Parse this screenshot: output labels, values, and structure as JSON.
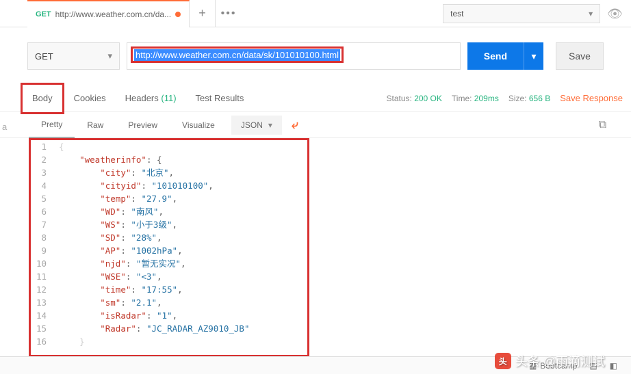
{
  "env": {
    "selected": "test"
  },
  "tab": {
    "method": "GET",
    "title": "http://www.weather.com.cn/da..."
  },
  "request": {
    "method": "GET",
    "url": "http://www.weather.com.cn/data/sk/101010100.html",
    "send": "Send",
    "save": "Save"
  },
  "respTabs": {
    "body": "Body",
    "cookies": "Cookies",
    "headers": "Headers",
    "headersCount": "(11)",
    "testResults": "Test Results"
  },
  "status": {
    "statusLbl": "Status:",
    "statusVal": "200 OK",
    "timeLbl": "Time:",
    "timeVal": "209ms",
    "sizeLbl": "Size:",
    "sizeVal": "656 B",
    "saveResponse": "Save Response"
  },
  "format": {
    "pretty": "Pretty",
    "raw": "Raw",
    "preview": "Preview",
    "visualize": "Visualize",
    "type": "JSON"
  },
  "json": {
    "l1_open": "{",
    "l2_k": "\"weatherinfo\"",
    "l2_open": ": {",
    "l3_k": "\"city\"",
    "l3_v": "\"北京\"",
    "l4_k": "\"cityid\"",
    "l4_v": "\"101010100\"",
    "l5_k": "\"temp\"",
    "l5_v": "\"27.9\"",
    "l6_k": "\"WD\"",
    "l6_v": "\"南风\"",
    "l7_k": "\"WS\"",
    "l7_v": "\"小于3级\"",
    "l8_k": "\"SD\"",
    "l8_v": "\"28%\"",
    "l9_k": "\"AP\"",
    "l9_v": "\"1002hPa\"",
    "l10_k": "\"njd\"",
    "l10_v": "\"暂无实况\"",
    "l11_k": "\"WSE\"",
    "l11_v": "\"<3\"",
    "l12_k": "\"time\"",
    "l12_v": "\"17:55\"",
    "l13_k": "\"sm\"",
    "l13_v": "\"2.1\"",
    "l14_k": "\"isRadar\"",
    "l14_v": "\"1\"",
    "l15_k": "\"Radar\"",
    "l15_v": "\"JC_RADAR_AZ9010_JB\"",
    "l16_close": "}"
  },
  "footer": {
    "bootcamp": "Bootcamp"
  },
  "watermark": "头条 @雨滴测试",
  "sideLetter": "a"
}
